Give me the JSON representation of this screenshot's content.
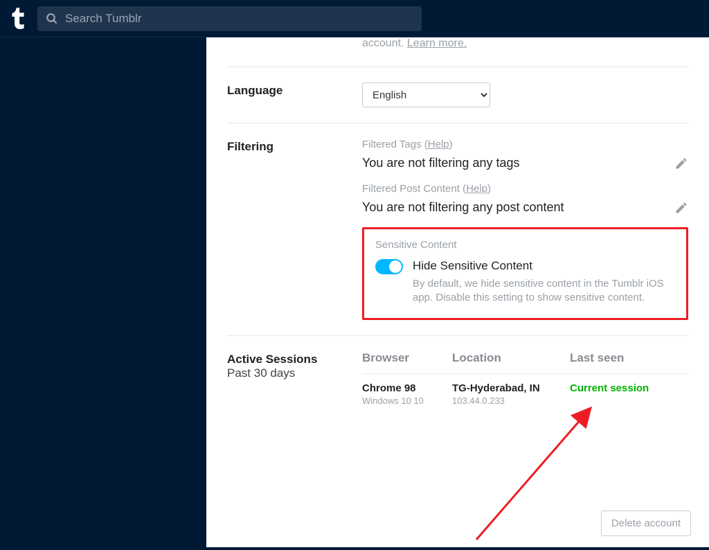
{
  "search": {
    "placeholder": "Search Tumblr"
  },
  "partial": {
    "tail": "account. ",
    "learn_more": "Learn more."
  },
  "language": {
    "label": "Language",
    "value": "English"
  },
  "filtering": {
    "label": "Filtering",
    "tags_hdr_pre": "Filtered Tags (",
    "help": "Help",
    "hdr_post": ")",
    "tags_empty": "You are not filtering any tags",
    "content_hdr_pre": "Filtered Post Content (",
    "content_empty": "You are not filtering any post content",
    "sensitive_hdr": "Sensitive Content",
    "sensitive_title": "Hide Sensitive Content",
    "sensitive_desc": "By default, we hide sensitive content in the Tumblr iOS app. Disable this setting to show sensitive content."
  },
  "sessions": {
    "label": "Active Sessions",
    "sub": "Past 30 days",
    "col_browser": "Browser",
    "col_location": "Location",
    "col_last": "Last seen",
    "row": {
      "browser": "Chrome 98",
      "os": "Windows 10 10",
      "location": "TG-Hyderabad, IN",
      "ip": "103.44.0.233",
      "last": "Current session"
    }
  },
  "delete": "Delete account"
}
